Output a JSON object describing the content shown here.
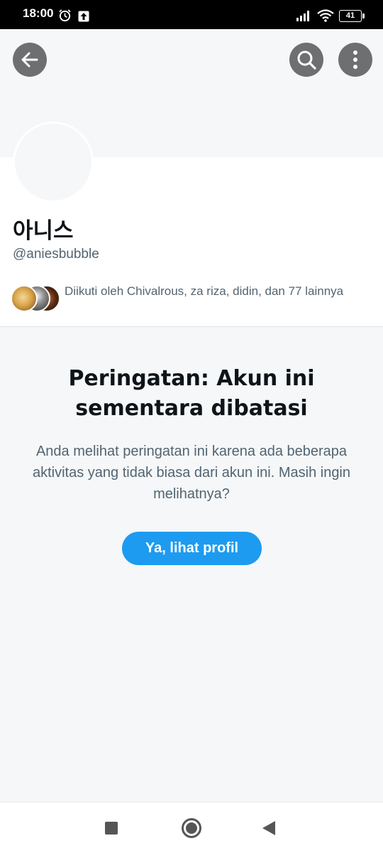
{
  "status_bar": {
    "time": "18:00",
    "battery": "41",
    "icons": [
      "alarm-icon",
      "upload-icon",
      "signal-icon",
      "wifi-icon",
      "battery-icon"
    ]
  },
  "toolbar": {
    "icons": [
      "arrow-left-icon",
      "search-icon",
      "more-vertical-icon"
    ]
  },
  "profile": {
    "display_name": "아니스",
    "handle": "@aniesbubble",
    "followed_by": "Diikuti oleh Chivalrous, za riza, didin, dan 77 lainnya"
  },
  "warning": {
    "title": "Peringatan: Akun ini sementara dibatasi",
    "body": "Anda melihat peringatan ini karena ada beberapa aktivitas yang tidak biasa dari akun ini. Masih ingin melihatnya?",
    "button_label": "Ya, lihat profil"
  },
  "colors": {
    "accent": "#1d9bf0",
    "text_primary": "#0f1419",
    "text_secondary": "#536471",
    "background_muted": "#f5f7f8",
    "overlay_button": "#6d6f71"
  }
}
